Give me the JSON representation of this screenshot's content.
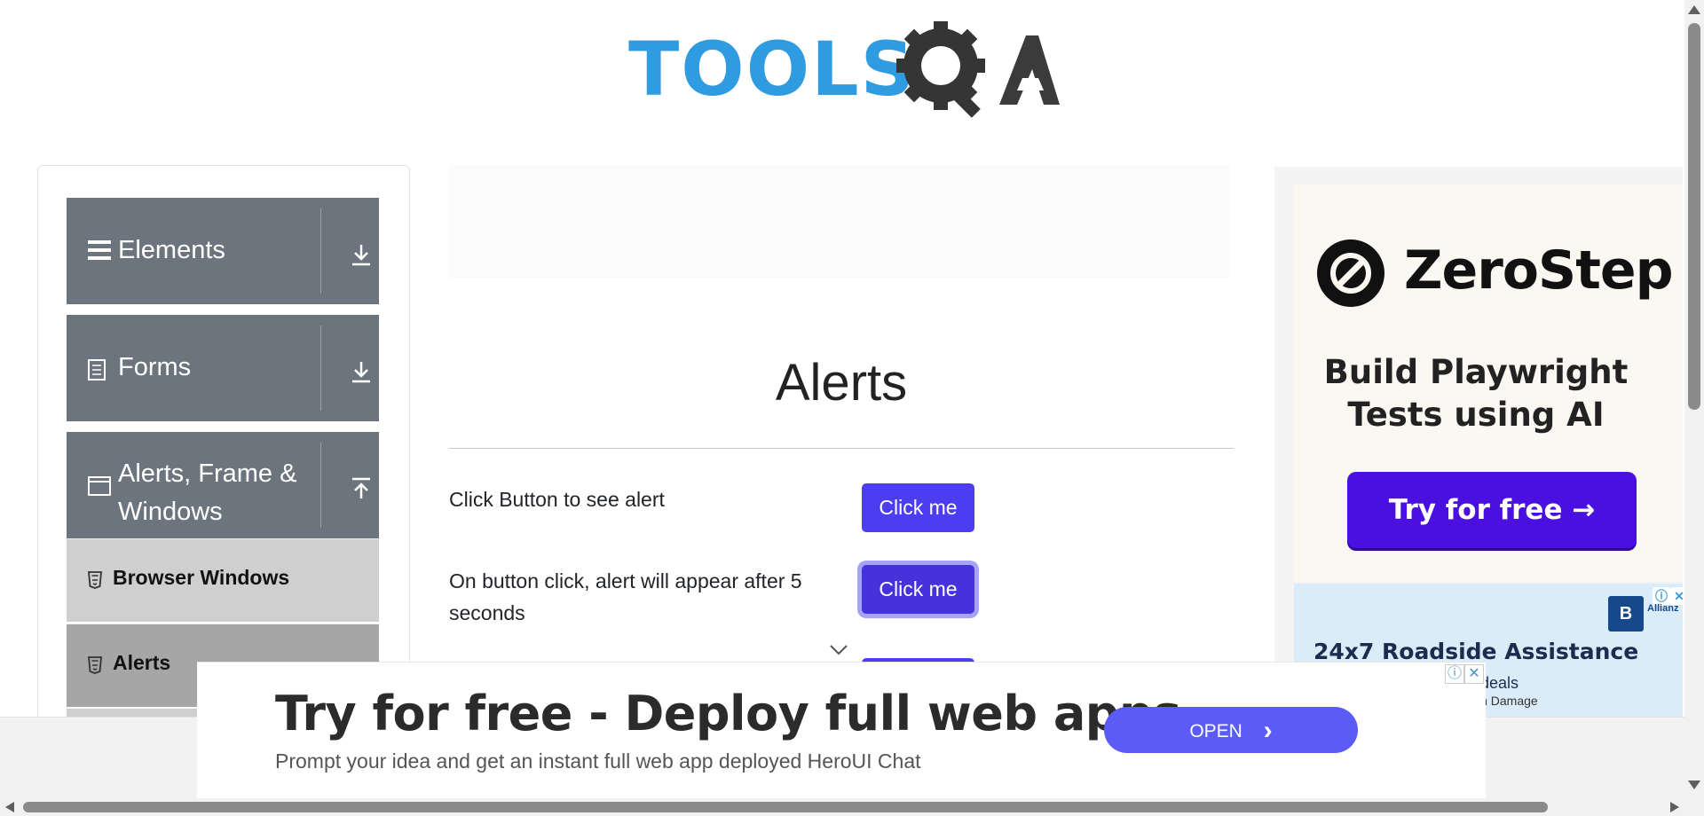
{
  "header": {
    "logo_text": "TOOLSQA",
    "logo_text_tools": "TOOLS"
  },
  "sidebar": {
    "groups": [
      {
        "label": "Elements",
        "icon": "hamburger-icon",
        "expanded": false
      },
      {
        "label": "Forms",
        "icon": "document-icon",
        "expanded": false
      },
      {
        "label": "Alerts, Frame &",
        "label2": "Windows",
        "icon": "window-icon",
        "expanded": true
      }
    ],
    "sub_items": [
      {
        "label": "Browser Windows",
        "icon": "html5-icon",
        "active": false
      },
      {
        "label": "Alerts",
        "icon": "html5-icon",
        "active": true
      }
    ]
  },
  "main": {
    "title": "Alerts",
    "rows": [
      {
        "label": "Click Button to see alert",
        "button": "Click me"
      },
      {
        "label": "On button click, alert will appear after 5",
        "label2": "seconds",
        "button": "Click me"
      }
    ]
  },
  "ad_right": {
    "brand": "ZeroStep",
    "headline_1": "Build Playwright",
    "headline_2": "Tests using AI",
    "cta": "Try for free →",
    "ad2_title": "24x7 Roadside Assistance",
    "ad2_sub": "t deals",
    "ad2_sub2": "wn Damage",
    "ad2_brand": "B",
    "ad2_brand2": "Allianz"
  },
  "bottom_ad": {
    "headline": "Try for free - Deploy full web apps",
    "subtext": "Prompt your idea and get an instant full web app deployed HeroUI Chat",
    "cta": "OPEN",
    "cta_chevron": "›"
  },
  "colors": {
    "accent_button": "#4d3df0",
    "sidebar_header": "#6c757d",
    "active_item": "#a6a6a6",
    "logo_blue": "#2f9be0",
    "logo_dark": "#3a3a3a"
  }
}
